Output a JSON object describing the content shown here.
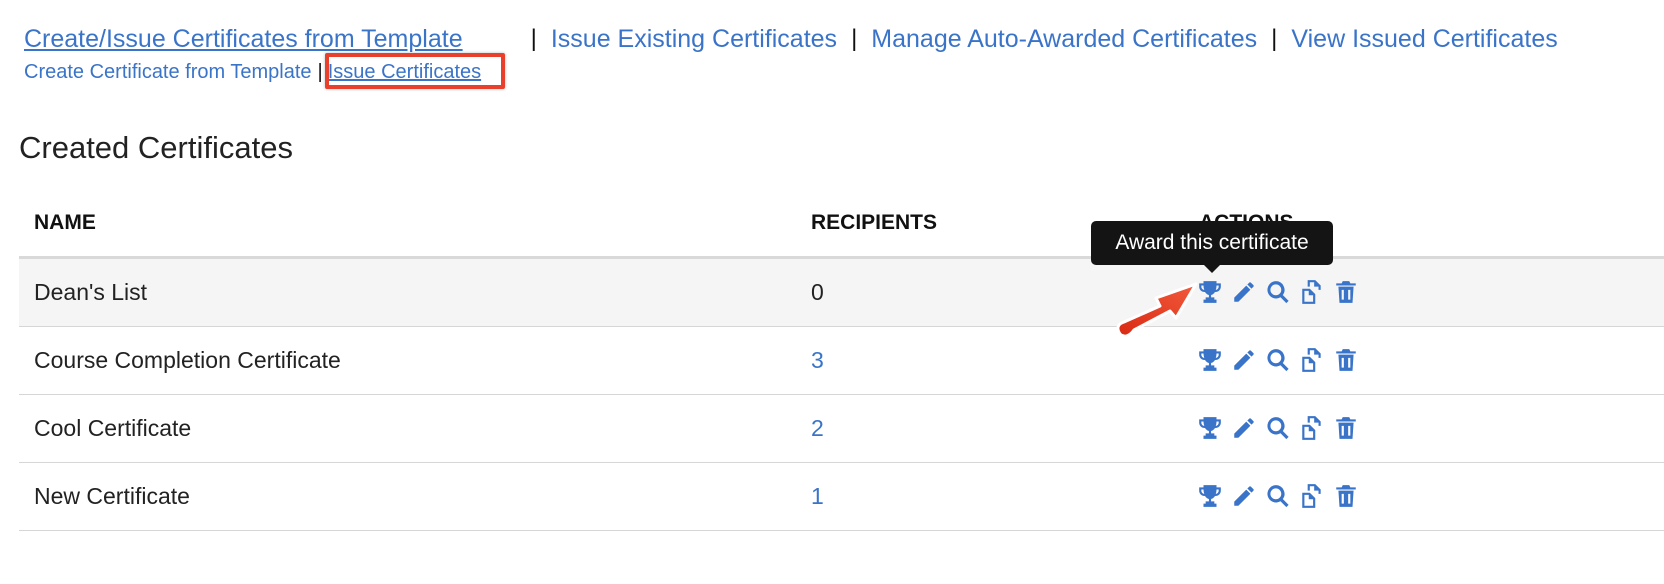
{
  "nav": {
    "links": [
      "Create/Issue Certificates from Template",
      "Issue Existing Certificates",
      "Manage Auto-Awarded Certificates",
      "View Issued Certificates"
    ],
    "separator": "|"
  },
  "subnav": {
    "create_label": "Create Certificate from Template",
    "issue_label": "Issue Certificates",
    "separator": "|"
  },
  "section_title": "Created Certificates",
  "table": {
    "headers": {
      "name": "NAME",
      "recipients": "RECIPIENTS",
      "actions": "ACTIONS"
    },
    "rows": [
      {
        "name": "Dean's List",
        "recipients": "0"
      },
      {
        "name": "Course Completion Certificate",
        "recipients": "3"
      },
      {
        "name": "Cool Certificate",
        "recipients": "2"
      },
      {
        "name": "New Certificate",
        "recipients": "1"
      }
    ]
  },
  "tooltip": "Award this certificate",
  "icons": [
    "trophy-icon",
    "pencil-icon",
    "magnifier-icon",
    "copy-icon",
    "trash-icon"
  ],
  "colors": {
    "link": "#3a74c9",
    "highlight": "#e8402c",
    "tooltip_bg": "#141414",
    "row_stripe": "#f5f5f5"
  }
}
